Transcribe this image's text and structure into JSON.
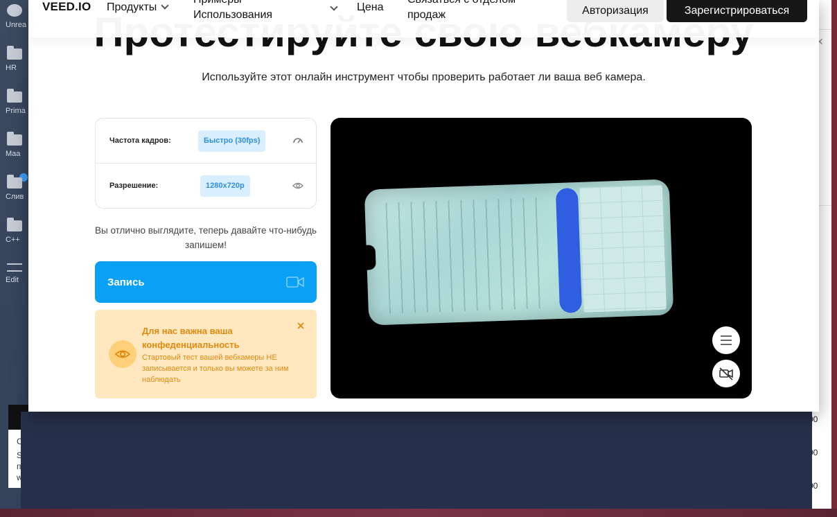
{
  "background": {
    "rail": [
      {
        "label": "Unrea",
        "kind": "chat"
      },
      {
        "label": "HR",
        "kind": "folder"
      },
      {
        "label": "Prima",
        "kind": "folder"
      },
      {
        "label": "Maa",
        "kind": "folder"
      },
      {
        "label": "Слив",
        "kind": "folder"
      },
      {
        "label": "C++",
        "kind": "folder"
      },
      {
        "label": "Edit",
        "kind": "slider"
      }
    ],
    "right_numbers": [
      "00",
      "00",
      "00"
    ],
    "bottom_letters": [
      "C",
      "S",
      "п",
      "w"
    ]
  },
  "nav": {
    "logo": "VEED.IO",
    "products": "Продукты",
    "examples": "Примеры Использования",
    "price": "Цена",
    "contact_sales": "Связаться с отделом продаж",
    "login": "Авторизация",
    "signup": "Зарегистрироваться"
  },
  "hero": {
    "title": "Протестируйте свою вебкамеру",
    "subtitle": "Используйте этот онлайн инструмент чтобы проверить работает ли ваша веб камера."
  },
  "settings": {
    "framerate_label": "Частота кадров:",
    "framerate_value": "Быстро (30fps)",
    "resolution_label": "Разрешение:",
    "resolution_value": "1280x720p"
  },
  "status_text": "Вы отлично выглядите, теперь давайте что-нибудь запишем!",
  "record_label": "Запись",
  "privacy": {
    "title": "Для нас важна ваша конфеденциальность",
    "text": "Стартовый тест вашей вебкамеры НЕ записывается и только вы можете за ним наблюдать"
  },
  "colors": {
    "accent_blue": "#0aa0f5",
    "chip_bg": "#d9efff",
    "privacy_bg": "#ffe7bf",
    "privacy_text": "#e08a10"
  }
}
